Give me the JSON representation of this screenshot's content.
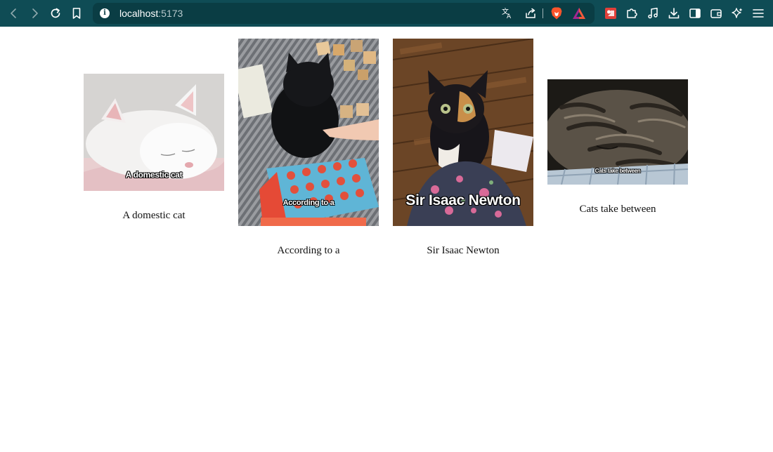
{
  "browser": {
    "url_host": "localhost",
    "url_port": ":5173",
    "icons": {
      "back": "chevron-left-icon",
      "forward": "chevron-right-icon",
      "reload": "reload-icon",
      "bookmark": "bookmark-icon",
      "site_info": "info-icon",
      "translate": "translate-icon",
      "share": "share-icon",
      "brave_shields": "brave-lion-icon",
      "brave_rewards": "rewards-triangle-icon",
      "extension_red": "extension-icon",
      "extensions": "puzzle-icon",
      "media": "music-note-icon",
      "downloads": "download-icon",
      "sidebar": "sidebar-icon",
      "wallet": "wallet-icon",
      "leo_ai": "sparkle-icon",
      "menu": "hamburger-menu-icon"
    },
    "colors": {
      "toolbar": "#0f4c55",
      "address_bar": "#0a3d44"
    }
  },
  "gallery": {
    "cards": [
      {
        "meme_caption": "A domestic cat",
        "label": "A domestic cat",
        "photo": "sleeping white cat"
      },
      {
        "meme_caption": "According to a",
        "label": "According to a",
        "photo": "black cat with connect-four game and alphabet blocks"
      },
      {
        "meme_caption": "Sir Isaac Newton",
        "label": "Sir Isaac Newton",
        "photo": "tortoiseshell kitten on wooden floor"
      },
      {
        "meme_caption": "Cats take between",
        "label": "Cats take between",
        "photo": "sleeping tabby cat"
      }
    ]
  }
}
